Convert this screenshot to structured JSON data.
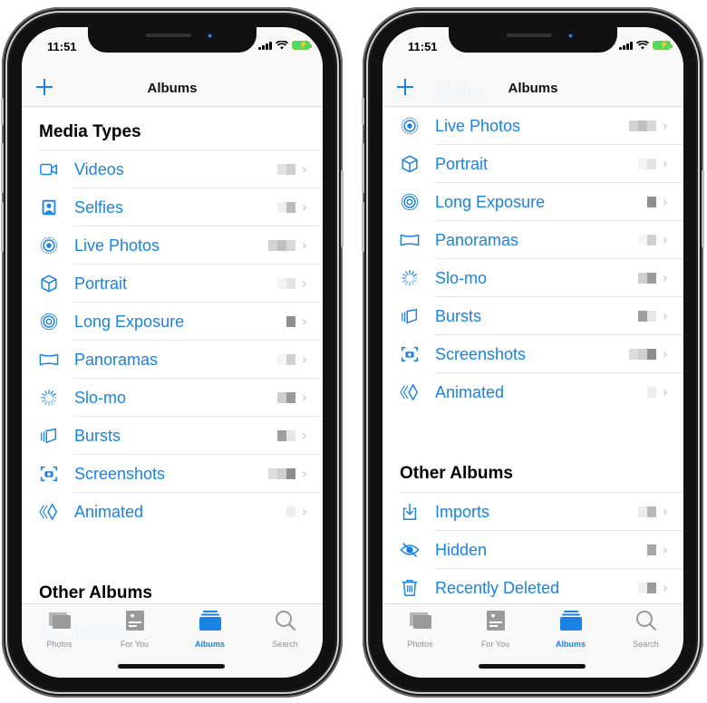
{
  "colors": {
    "accent": "#1a82e2",
    "tab_inactive": "#8e8e93",
    "battery": "#4cd964"
  },
  "phones": [
    {
      "status": {
        "time": "11:51"
      },
      "nav": {
        "title": "Albums",
        "add_icon": "plus-icon"
      },
      "media_types_title": "Media Types",
      "media_items": [
        {
          "label": "Videos",
          "icon": "video-icon"
        },
        {
          "label": "Selfies",
          "icon": "selfie-icon"
        },
        {
          "label": "Live Photos",
          "icon": "live-photos-icon"
        },
        {
          "label": "Portrait",
          "icon": "cube-icon"
        },
        {
          "label": "Long Exposure",
          "icon": "long-exposure-icon"
        },
        {
          "label": "Panoramas",
          "icon": "panorama-icon"
        },
        {
          "label": "Slo-mo",
          "icon": "slomo-icon"
        },
        {
          "label": "Bursts",
          "icon": "bursts-icon"
        },
        {
          "label": "Screenshots",
          "icon": "screenshot-icon"
        },
        {
          "label": "Animated",
          "icon": "animated-icon"
        }
      ],
      "other_albums_title": "Other Albums",
      "other_items": [
        {
          "label": "Imports",
          "icon": "imports-icon"
        }
      ]
    },
    {
      "status": {
        "time": "11:51"
      },
      "nav": {
        "title": "Albums",
        "add_icon": "plus-icon"
      },
      "partial_item": {
        "label": "Selfies",
        "icon": "selfie-icon"
      },
      "media_items": [
        {
          "label": "Live Photos",
          "icon": "live-photos-icon"
        },
        {
          "label": "Portrait",
          "icon": "cube-icon"
        },
        {
          "label": "Long Exposure",
          "icon": "long-exposure-icon"
        },
        {
          "label": "Panoramas",
          "icon": "panorama-icon"
        },
        {
          "label": "Slo-mo",
          "icon": "slomo-icon"
        },
        {
          "label": "Bursts",
          "icon": "bursts-icon"
        },
        {
          "label": "Screenshots",
          "icon": "screenshot-icon"
        },
        {
          "label": "Animated",
          "icon": "animated-icon"
        }
      ],
      "other_albums_title": "Other Albums",
      "other_items": [
        {
          "label": "Imports",
          "icon": "imports-icon"
        },
        {
          "label": "Hidden",
          "icon": "hidden-icon"
        },
        {
          "label": "Recently Deleted",
          "icon": "trash-icon"
        }
      ]
    }
  ],
  "tabbar": {
    "tabs": [
      {
        "label": "Photos",
        "icon": "photos-tab-icon",
        "active": false
      },
      {
        "label": "For You",
        "icon": "for-you-tab-icon",
        "active": false
      },
      {
        "label": "Albums",
        "icon": "albums-tab-icon",
        "active": true
      },
      {
        "label": "Search",
        "icon": "search-tab-icon",
        "active": false
      }
    ]
  }
}
